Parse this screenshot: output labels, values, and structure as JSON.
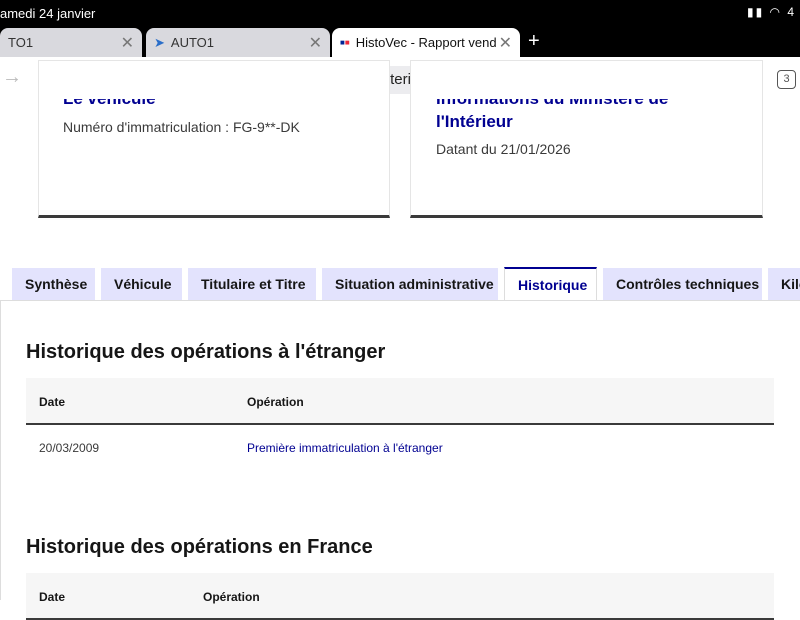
{
  "status": {
    "date": "amedi 24 janvier",
    "icons": "▮▮ ◠ 4"
  },
  "browser_tabs": [
    {
      "label": "TO1"
    },
    {
      "label": "AUTO1"
    },
    {
      "label": "HistoVec - Rapport vend"
    }
  ],
  "url": "histovec.interieur.gouv.fr",
  "tabs_count": "3",
  "cards": [
    {
      "title": "Le véhicule",
      "text": "Numéro d'immatriculation : FG-9**-DK"
    },
    {
      "title_line1": "Informations du Ministère de",
      "title_line2": "l'Intérieur",
      "text": "Datant du 21/01/2026"
    }
  ],
  "tabs": [
    "Synthèse",
    "Véhicule",
    "Titulaire et Titre",
    "Situation administrative",
    "Historique",
    "Contrôles techniques",
    "Kilo"
  ],
  "sections": [
    {
      "title": "Historique des opérations à l'étranger",
      "headers": [
        "Date",
        "Opération"
      ],
      "rows": [
        {
          "date": "20/03/2009",
          "operation": "Première immatriculation à l'étranger"
        }
      ]
    },
    {
      "title": "Historique des opérations en France",
      "headers": [
        "Date",
        "Opération"
      ]
    }
  ]
}
